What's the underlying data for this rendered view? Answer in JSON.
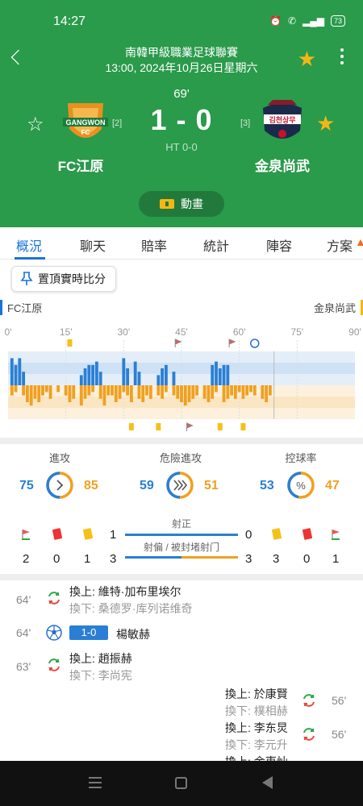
{
  "status": {
    "time": "14:27",
    "battery": "73"
  },
  "header": {
    "league": "南韓甲級職業足球聯賽",
    "kickoff": "13:00, 2024年10月26日星期六",
    "minute": "69'",
    "score": "1 - 0",
    "halftime": "HT 0-0",
    "home": {
      "name": "FC江原",
      "rank": "[2]",
      "logo_text": "GANGWON",
      "logo_sub": "FC"
    },
    "away": {
      "name": "金泉尚武",
      "rank": "[3]",
      "logo_text": "김천상무"
    },
    "animation_label": "動畫"
  },
  "tabs": [
    "概況",
    "聊天",
    "賠率",
    "統計",
    "陣容",
    "方案"
  ],
  "pin_label": "置頂實時比分",
  "chart_data": {
    "type": "bar",
    "home_label": "FC江原",
    "away_label": "金泉尚武",
    "x_ticks": [
      "0'",
      "15'",
      "30'",
      "45'",
      "60'",
      "75'",
      "90'"
    ],
    "xlim": [
      0,
      90
    ],
    "current_minute": 69,
    "home_pressure": [
      8,
      6,
      8,
      4,
      0,
      0,
      0,
      0,
      0,
      0,
      0,
      0,
      0,
      0,
      0,
      0,
      0,
      0,
      3,
      5,
      6,
      6,
      7,
      4,
      0,
      0,
      0,
      0,
      0,
      8,
      5,
      0,
      7,
      4,
      0,
      0,
      0,
      0,
      3,
      5,
      6,
      0,
      4,
      0,
      0,
      0,
      0,
      0,
      0,
      0,
      0,
      0,
      6,
      7,
      5,
      6,
      6,
      0,
      0,
      0,
      0,
      0,
      0,
      0,
      0,
      0,
      0,
      0,
      0
    ],
    "away_pressure": [
      3,
      2,
      0,
      3,
      5,
      6,
      4,
      5,
      3,
      2,
      4,
      0,
      2,
      0,
      3,
      5,
      4,
      0,
      6,
      4,
      3,
      2,
      0,
      4,
      6,
      3,
      3,
      5,
      4,
      2,
      3,
      5,
      0,
      4,
      5,
      3,
      4,
      0,
      3,
      4,
      2,
      0,
      3,
      4,
      5,
      6,
      5,
      4,
      3,
      0,
      4,
      5,
      4,
      2,
      0,
      5,
      4,
      3,
      4,
      2,
      4,
      3,
      2,
      3,
      0,
      4,
      5,
      3,
      0
    ],
    "events_top": [
      {
        "minute": 16,
        "kind": "yellow"
      },
      {
        "minute": 44,
        "kind": "corner"
      },
      {
        "minute": 58,
        "kind": "corner"
      },
      {
        "minute": 64,
        "kind": "goal"
      }
    ],
    "events_bottom": [
      {
        "minute": 32,
        "kind": "yellow"
      },
      {
        "minute": 39,
        "kind": "yellow"
      },
      {
        "minute": 47,
        "kind": "corner"
      },
      {
        "minute": 55,
        "kind": "yellow"
      },
      {
        "minute": 61,
        "kind": "yellow"
      }
    ]
  },
  "stats": {
    "attack": {
      "label": "進攻",
      "home": "75",
      "away": "85"
    },
    "dangerous": {
      "label": "危險進攻",
      "home": "59",
      "away": "51"
    },
    "possession": {
      "label": "控球率",
      "home": "53",
      "away": "47"
    },
    "shots_on": {
      "label": "射正",
      "home": "1",
      "away": "0"
    },
    "shots_off": {
      "label": "射偏 / 被封堵射门",
      "home": "3",
      "away": "3"
    },
    "corners": {
      "home": "2",
      "away": "1"
    },
    "red": {
      "home": "0",
      "away": "0"
    },
    "yellow": {
      "home": "1",
      "away": "3"
    }
  },
  "events": [
    {
      "minute": "64'",
      "side": "home",
      "type": "sub",
      "in": "換上: 維特·加布里埃尔",
      "out": "換下: 桑德罗·库列诺维奇"
    },
    {
      "minute": "64'",
      "side": "home",
      "type": "goal",
      "score": "1-0",
      "player": "楊敏赫"
    },
    {
      "minute": "63'",
      "side": "home",
      "type": "sub",
      "in": "換上: 趙振赫",
      "out": "換下: 李尚宪"
    },
    {
      "minute": "56'",
      "side": "away",
      "type": "sub",
      "in": "換上: 於康賢",
      "out": "換下: 樸相赫"
    },
    {
      "minute": "56'",
      "side": "away",
      "type": "sub",
      "in": "換上: 李东炅",
      "out": "換下: 李元升"
    },
    {
      "minute": "",
      "side": "away",
      "type": "sub",
      "in": "換上: 金東灿",
      "out": ""
    }
  ],
  "colors": {
    "header": "#2a9a4b",
    "home": "#2a7fd4",
    "away": "#f0a020"
  }
}
